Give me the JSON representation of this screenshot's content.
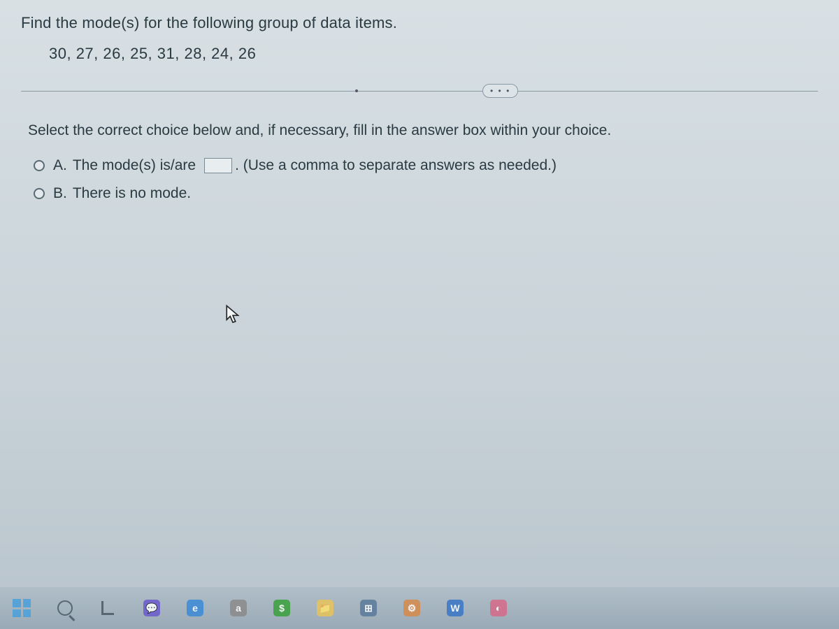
{
  "question": {
    "prompt": "Find the mode(s) for the following group of data items.",
    "data_items": "30, 27, 26, 25, 31, 28, 24, 26"
  },
  "divider_label": "• • •",
  "instruction": "Select the correct choice below and, if necessary, fill in the answer box within your choice.",
  "choices": {
    "a": {
      "label": "A.",
      "text_before": "The mode(s) is/are",
      "text_after": ".",
      "hint": "(Use a comma to separate answers as needed.)"
    },
    "b": {
      "label": "B.",
      "text": "There is no mode."
    }
  },
  "taskbar": {
    "items": [
      {
        "name": "start-icon"
      },
      {
        "name": "search-icon"
      },
      {
        "name": "task-view-icon"
      },
      {
        "name": "chat-icon"
      },
      {
        "name": "edge-icon"
      },
      {
        "name": "amazon-icon"
      },
      {
        "name": "store-icon"
      },
      {
        "name": "explorer-icon"
      },
      {
        "name": "widgets-icon"
      },
      {
        "name": "settings-icon"
      },
      {
        "name": "word-icon",
        "letter": "W"
      },
      {
        "name": "copilot-icon"
      }
    ]
  }
}
